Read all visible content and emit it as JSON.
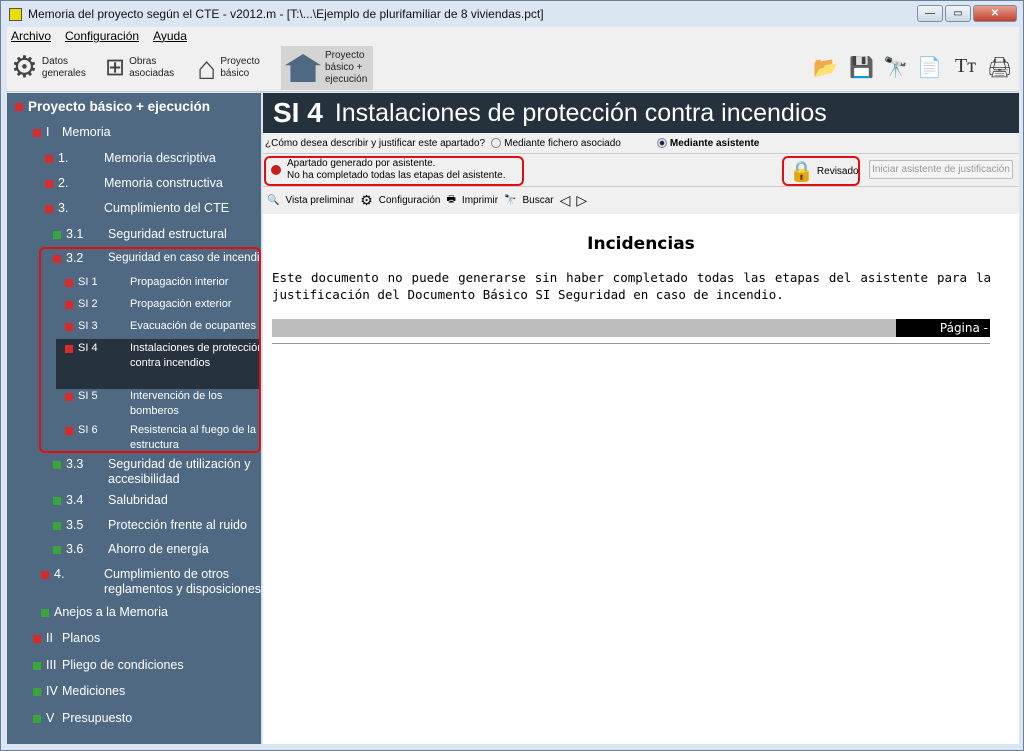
{
  "window": {
    "title": "Memoria del proyecto según el CTE - v2012.m - [T:\\...\\Ejemplo de plurifamiliar de 8 viviendas.pct]"
  },
  "menu": [
    "Archivo",
    "Configuración",
    "Ayuda"
  ],
  "toolbar": {
    "items": [
      {
        "label": "Datos generales"
      },
      {
        "label": "Obras asociadas"
      },
      {
        "label": "Proyecto básico"
      },
      {
        "label": "Proyecto básico + ejecución"
      }
    ]
  },
  "sidebar": {
    "items": [
      {
        "num": "",
        "label": "Proyecto básico + ejecución",
        "status": "red"
      },
      {
        "num": "I",
        "label": "Memoria",
        "status": "red"
      },
      {
        "num": "1.",
        "label": "Memoria descriptiva",
        "status": "red"
      },
      {
        "num": "2.",
        "label": "Memoria constructiva",
        "status": "red"
      },
      {
        "num": "3.",
        "label": "Cumplimiento del CTE",
        "status": "red"
      },
      {
        "num": "3.1",
        "label": "Seguridad estructural",
        "status": "green"
      },
      {
        "num": "3.2",
        "label": "Seguridad en caso de incendio",
        "status": "red"
      },
      {
        "num": "SI 1",
        "label": "Propagación interior",
        "status": "red"
      },
      {
        "num": "SI 2",
        "label": "Propagación exterior",
        "status": "red"
      },
      {
        "num": "SI 3",
        "label": "Evacuación de ocupantes",
        "status": "red"
      },
      {
        "num": "SI 4",
        "label": "Instalaciones de protección contra incendios",
        "status": "red"
      },
      {
        "num": "SI 5",
        "label": "Intervención de los bomberos",
        "status": "red"
      },
      {
        "num": "SI 6",
        "label": "Resistencia al fuego de la estructura",
        "status": "red"
      },
      {
        "num": "3.3",
        "label": "Seguridad de utilización y accesibilidad",
        "status": "green"
      },
      {
        "num": "3.4",
        "label": "Salubridad",
        "status": "green"
      },
      {
        "num": "3.5",
        "label": "Protección frente al ruido",
        "status": "green"
      },
      {
        "num": "3.6",
        "label": "Ahorro de energía",
        "status": "green"
      },
      {
        "num": "4.",
        "label": "Cumplimiento de otros reglamentos y disposiciones",
        "status": "red"
      },
      {
        "num": "",
        "label": "Anejos a la Memoria",
        "status": "green"
      },
      {
        "num": "II",
        "label": "Planos",
        "status": "red"
      },
      {
        "num": "III",
        "label": "Pliego de condiciones",
        "status": "green"
      },
      {
        "num": "IV",
        "label": "Mediciones",
        "status": "green"
      },
      {
        "num": "V",
        "label": "Presupuesto",
        "status": "green"
      }
    ]
  },
  "main": {
    "code": "SI 4",
    "title": "Instalaciones de protección contra incendios",
    "question": "¿Cómo desea describir y justificar este apartado?",
    "option1": "Mediante fichero asociado",
    "option2": "Mediante asistente",
    "status_line1": "Apartado generado por asistente.",
    "status_line2": "No ha completado todas las etapas del asistente.",
    "reviewed": "Revisado",
    "start_wizard": "Iniciar asistente de justificación",
    "tools": [
      "Vista preliminar",
      "Configuración",
      "Imprimir",
      "Buscar"
    ],
    "doc_title": "Incidencias",
    "doc_text": "Este documento no puede generarse sin haber completado todas las etapas del asistente para la justificación del Documento Básico SI Seguridad en caso de incendio.",
    "page_label": "Página -"
  }
}
